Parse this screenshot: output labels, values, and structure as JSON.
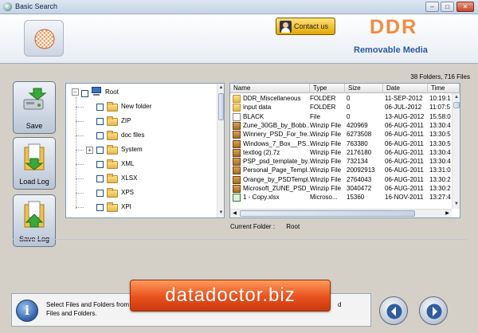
{
  "window": {
    "title": "Basic Search"
  },
  "header": {
    "contact_label": "Contact us",
    "brand": "DDR",
    "subbrand": "Removable Media"
  },
  "summary": {
    "counts": "38 Folders, 716 Files"
  },
  "sidebar": {
    "save_label": "Save",
    "load_log_label": "Load Log",
    "save_log_label": "Save Log"
  },
  "tree": {
    "root": "Root",
    "items": [
      {
        "label": "New folder",
        "expandable": false
      },
      {
        "label": "ZIP",
        "expandable": false
      },
      {
        "label": "doc files",
        "expandable": false
      },
      {
        "label": "System",
        "expandable": true
      },
      {
        "label": "XML",
        "expandable": false
      },
      {
        "label": "XLSX",
        "expandable": false
      },
      {
        "label": "XPS",
        "expandable": false
      },
      {
        "label": "XPI",
        "expandable": false
      }
    ]
  },
  "filelist": {
    "columns": [
      "Name",
      "Type",
      "Size",
      "Date",
      "Time"
    ],
    "rows": [
      {
        "icon": "folder",
        "name": "DDR_Miscellaneous",
        "type": "FOLDER",
        "size": "0",
        "date": "11-SEP-2012",
        "time": "10:19:1"
      },
      {
        "icon": "folder",
        "name": "input data",
        "type": "FOLDER",
        "size": "0",
        "date": "06-JUL-2012",
        "time": "11:07:5"
      },
      {
        "icon": "file",
        "name": "BLACK",
        "type": "File",
        "size": "0",
        "date": "13-AUG-2012",
        "time": "15:58:0"
      },
      {
        "icon": "zip",
        "name": "Zune_30GB_by_Bobb...",
        "type": "Winzip File",
        "size": "420969",
        "date": "06-AUG-2011",
        "time": "13:30:4"
      },
      {
        "icon": "zip",
        "name": "Winnery_PSD_For_fre...",
        "type": "Winzip File",
        "size": "6273508",
        "date": "06-AUG-2011",
        "time": "13:30:5"
      },
      {
        "icon": "zip",
        "name": "Windows_7_Box__PS...",
        "type": "Winzip File",
        "size": "763380",
        "date": "06-AUG-2011",
        "time": "13:30:5"
      },
      {
        "icon": "zip",
        "name": "textlog (2).7z",
        "type": "Winzip File",
        "size": "2176180",
        "date": "06-AUG-2011",
        "time": "13:30:4"
      },
      {
        "icon": "zip",
        "name": "PSP_psd_template_by...",
        "type": "Winzip File",
        "size": "732134",
        "date": "06-AUG-2011",
        "time": "13:30:4"
      },
      {
        "icon": "zip",
        "name": "Personal_Page_Templ...",
        "type": "Winzip File",
        "size": "20092913",
        "date": "06-AUG-2011",
        "time": "13:31:0"
      },
      {
        "icon": "zip",
        "name": "Orange_by_PSDTempl...",
        "type": "Winzip File",
        "size": "2764043",
        "date": "06-AUG-2011",
        "time": "13:30:2"
      },
      {
        "icon": "zip",
        "name": "Microsoft_ZUNE_PSD_...",
        "type": "Winzip File",
        "size": "3040472",
        "date": "06-AUG-2011",
        "time": "13:30:2"
      },
      {
        "icon": "xlsx",
        "name": "1 - Copy.xlsx",
        "type": "Microso...",
        "size": "15360",
        "date": "16-NOV-2011",
        "time": "13:27:4"
      }
    ]
  },
  "current_folder": {
    "label": "Current Folder :",
    "value": "Root"
  },
  "status": {
    "text_line1": "Select Files and Folders from le",
    "text_line1_end": "d",
    "text_line2": "Files and Folders."
  },
  "banner": {
    "text": "datadoctor.biz"
  }
}
